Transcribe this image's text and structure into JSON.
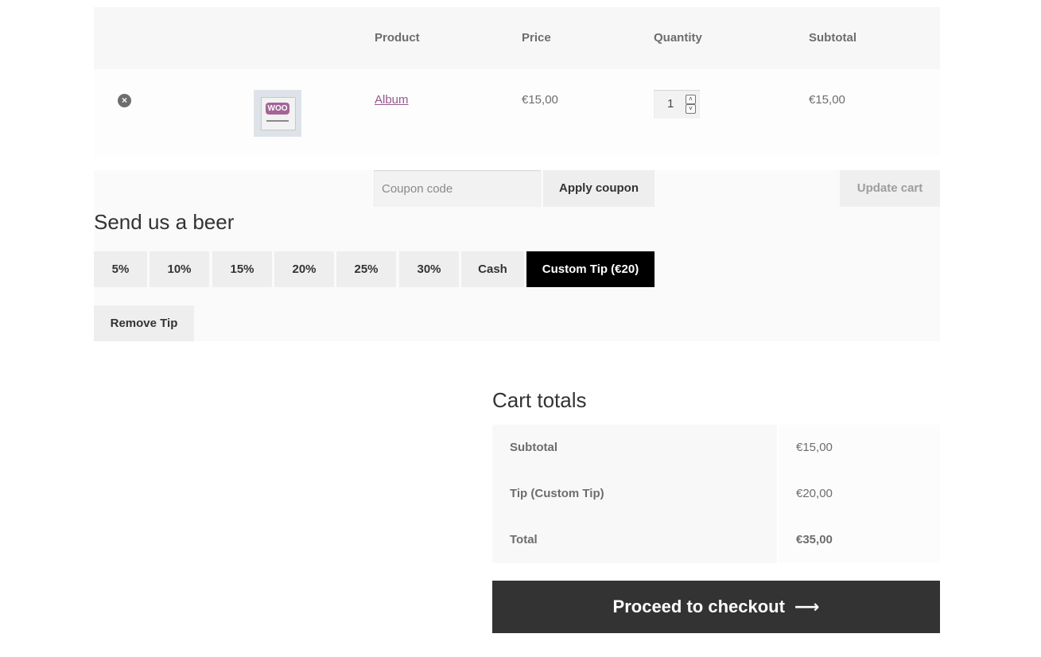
{
  "cart_table": {
    "headers": {
      "product": "Product",
      "price": "Price",
      "quantity": "Quantity",
      "subtotal": "Subtotal"
    },
    "rows": [
      {
        "remove_icon": "close-circle-icon",
        "thumbnail_badge": "WOO",
        "product_name": "Album",
        "price": "€15,00",
        "quantity": "1",
        "subtotal": "€15,00"
      }
    ]
  },
  "actions": {
    "coupon_placeholder": "Coupon code",
    "apply_coupon_label": "Apply coupon",
    "update_cart_label": "Update cart"
  },
  "tips": {
    "title": "Send us a beer",
    "options": [
      "5%",
      "10%",
      "15%",
      "20%",
      "25%",
      "30%",
      "Cash",
      "Custom Tip (€20)"
    ],
    "active_option": "Custom Tip (€20)",
    "remove_label": "Remove Tip"
  },
  "cart_totals": {
    "title": "Cart totals",
    "rows": [
      {
        "label": "Subtotal",
        "value": "€15,00"
      },
      {
        "label": "Tip (Custom Tip)",
        "value": "€20,00"
      },
      {
        "label": "Total",
        "value": "€35,00"
      }
    ],
    "checkout_label": "Proceed to checkout",
    "checkout_icon": "arrow-right-icon"
  },
  "colors": {
    "link": "#96588a",
    "active_tip_bg": "#000000",
    "checkout_bg": "#333333",
    "woo_brand": "#a46497"
  }
}
